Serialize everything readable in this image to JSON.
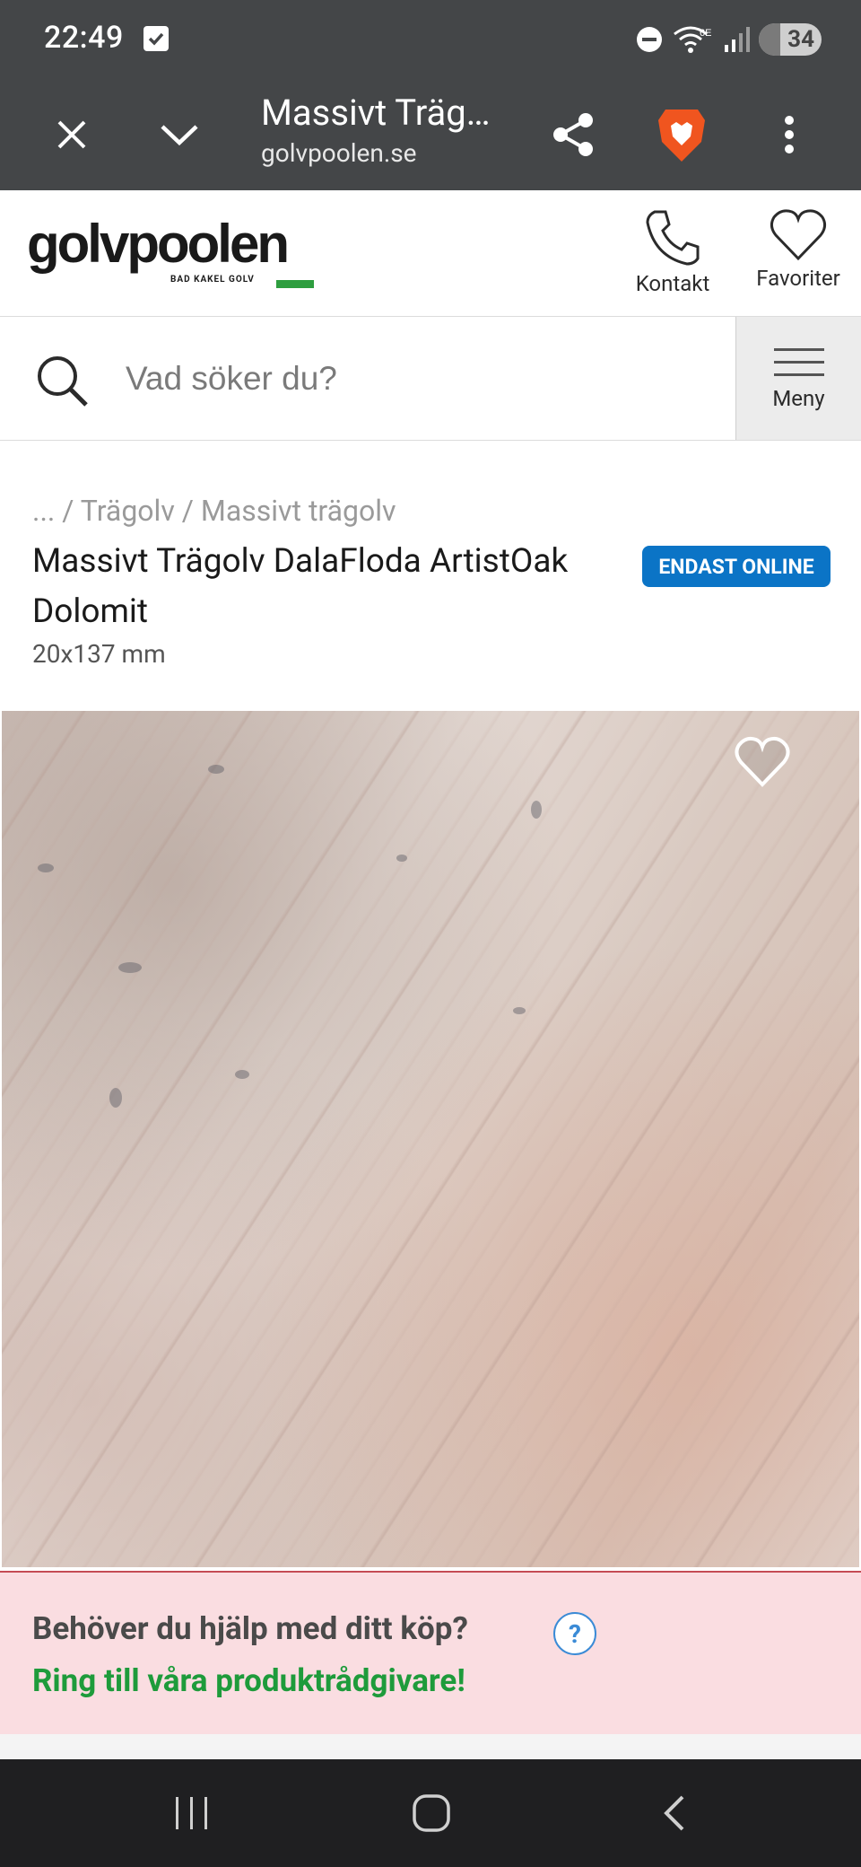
{
  "status_bar": {
    "time": "22:49",
    "battery": "34",
    "icons": [
      "checkbox-icon",
      "dnd-icon",
      "wifi-6e-icon",
      "signal-icon",
      "battery-icon"
    ]
  },
  "browser": {
    "tab_title": "Massivt Trägolv DalaFloda ArtistOak Dolomit",
    "url": "golvpoolen.se",
    "icons": [
      "close-icon",
      "chevron-down-icon",
      "share-icon",
      "brave-lion-icon",
      "more-vert-icon"
    ]
  },
  "site": {
    "logo_text": "golvpoolen",
    "logo_tagline": "BAD KAKEL GOLV",
    "contact_label": "Kontakt",
    "favorites_label": "Favoriter",
    "menu_label": "Meny",
    "search_placeholder": "Vad söker du?"
  },
  "product": {
    "breadcrumb": [
      "...",
      "Trägolv",
      "Massivt trägolv"
    ],
    "title": "Massivt Trägolv DalaFloda ArtistOak Dolomit",
    "dimensions": "20x137 mm",
    "badge": "ENDAST ONLINE"
  },
  "help": {
    "question": "Behöver du hjälp med ditt köp?",
    "help_icon_glyph": "?",
    "cta": "Ring till våra produktrådgivare!"
  },
  "colors": {
    "chrome_bg": "#444648",
    "badge_blue": "#0b74c6",
    "brand_green": "#2e9e3f",
    "help_bg": "#fadde1",
    "cta_green": "#1e9b3b"
  }
}
